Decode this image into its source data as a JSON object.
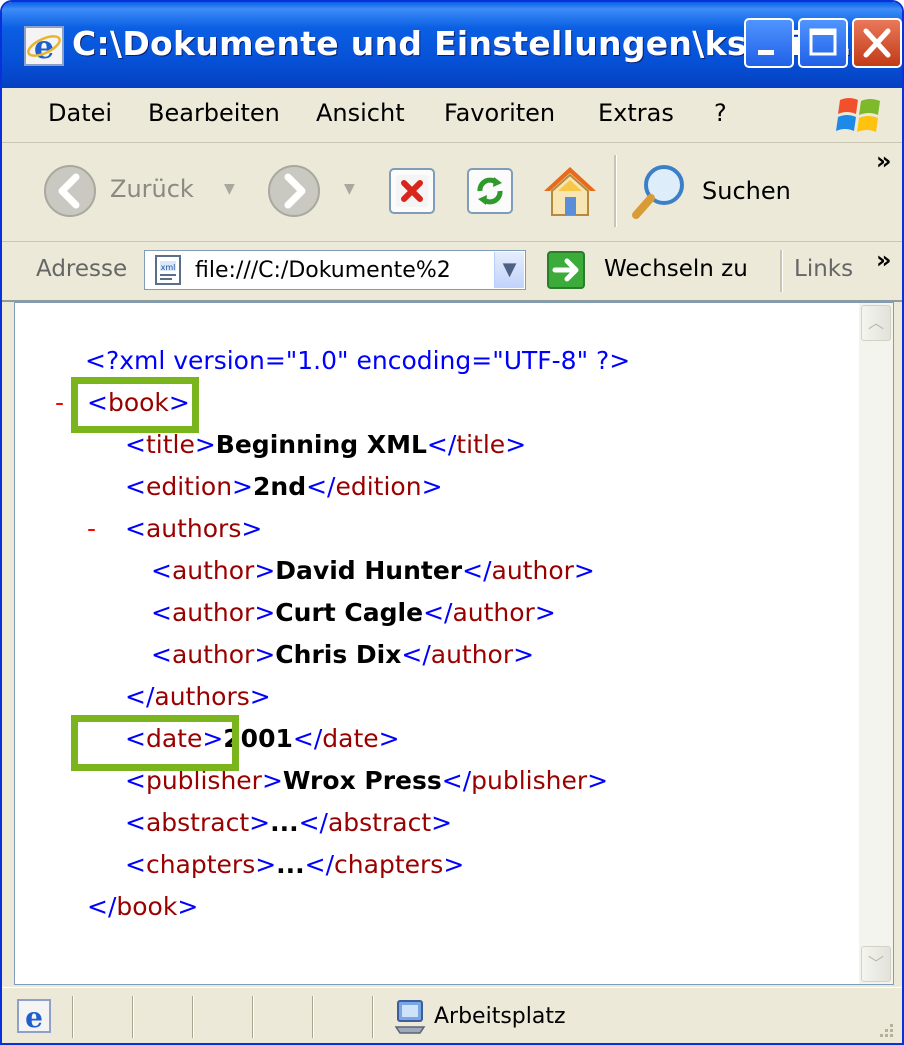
{
  "window": {
    "title": "C:\\Dokumente und Einstellungen\\kschil..."
  },
  "menu": {
    "items": [
      {
        "label": "Datei"
      },
      {
        "label": "Bearbeiten"
      },
      {
        "label": "Ansicht"
      },
      {
        "label": "Favoriten"
      },
      {
        "label": "Extras"
      },
      {
        "label": "?"
      }
    ]
  },
  "toolbar": {
    "back_label": "Zurück",
    "search_label": "Suchen",
    "chevron": "»"
  },
  "address": {
    "label": "Adresse",
    "value": "file:///C:/Dokumente%2",
    "go_label": "Wechseln zu",
    "links_label": "Links",
    "chevron": "»"
  },
  "xml": {
    "declaration": "<?xml version=\"1.0\" encoding=\"UTF-8\" ?>",
    "collapse": "-",
    "book_open": "book",
    "title_tag": "title",
    "title_value": "Beginning XML",
    "edition_tag": "edition",
    "edition_value": "2nd",
    "authors_tag": "authors",
    "author_tag": "author",
    "authors": [
      "David Hunter",
      "Curt Cagle",
      "Chris Dix"
    ],
    "date_tag": "date",
    "date_value": "2001",
    "publisher_tag": "publisher",
    "publisher_value": "Wrox Press",
    "abstract_tag": "abstract",
    "abstract_value": "...",
    "chapters_tag": "chapters",
    "chapters_value": "..."
  },
  "status": {
    "zone": "Arbeitsplatz"
  },
  "colors": {
    "highlight": "#7ab51d",
    "markup": "#0000ff",
    "tagname": "#990000",
    "collapse": "#ff0000"
  }
}
